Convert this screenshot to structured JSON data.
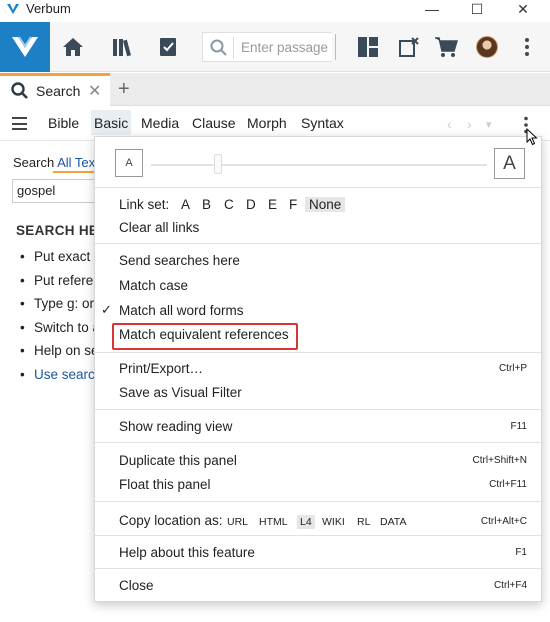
{
  "titlebar": {
    "title": "Verbum",
    "minimize": "—",
    "maximize": "☐",
    "close": "✕"
  },
  "toolbar": {
    "passage_placeholder": "Enter passage o",
    "colors": {
      "brand": "#1d80c4",
      "toolbar_bg": "#f6f6f6"
    }
  },
  "tabs": [
    {
      "label": "Search",
      "close": "✕"
    }
  ],
  "add_tab": "+",
  "search_types": [
    "Bible",
    "Basic",
    "Media",
    "Clause",
    "Morph",
    "Syntax"
  ],
  "search_type_active": "Basic",
  "nav": {
    "back": "‹",
    "forward": "›",
    "dropdown": "▾"
  },
  "search_panel": {
    "search_label": "Search",
    "scope": "All Text",
    "query": "gospel",
    "help_title": "SEARCH HE",
    "help_items": [
      "Put exact p",
      "Put referer",
      "Type g: or",
      "Switch to a",
      "Help on se",
      "Use search"
    ]
  },
  "menu": {
    "font_small": "A",
    "font_large": "A",
    "link_set_label": "Link set:",
    "link_set_options": [
      "A",
      "B",
      "C",
      "D",
      "E",
      "F",
      "None"
    ],
    "link_set_selected": "None",
    "clear_links": "Clear all links",
    "send_searches": "Send searches here",
    "match_case": "Match case",
    "match_forms": "Match all word forms",
    "match_forms_checked": "✓",
    "match_refs": "Match equivalent references",
    "print_export": "Print/Export…",
    "print_shortcut": "Ctrl+P",
    "save_visual": "Save as Visual Filter",
    "reading_view": "Show reading view",
    "reading_shortcut": "F11",
    "duplicate": "Duplicate this panel",
    "duplicate_shortcut": "Ctrl+Shift+N",
    "float": "Float this panel",
    "float_shortcut": "Ctrl+F11",
    "copy_label": "Copy location as:",
    "copy_options": [
      "URL",
      "HTML",
      "L4",
      "WIKI",
      "RL",
      "DATA"
    ],
    "copy_selected": "L4",
    "copy_shortcut": "Ctrl+Alt+C",
    "help": "Help about this feature",
    "help_shortcut": "F1",
    "close": "Close",
    "close_shortcut": "Ctrl+F4",
    "highlight_color": "#d83535"
  }
}
